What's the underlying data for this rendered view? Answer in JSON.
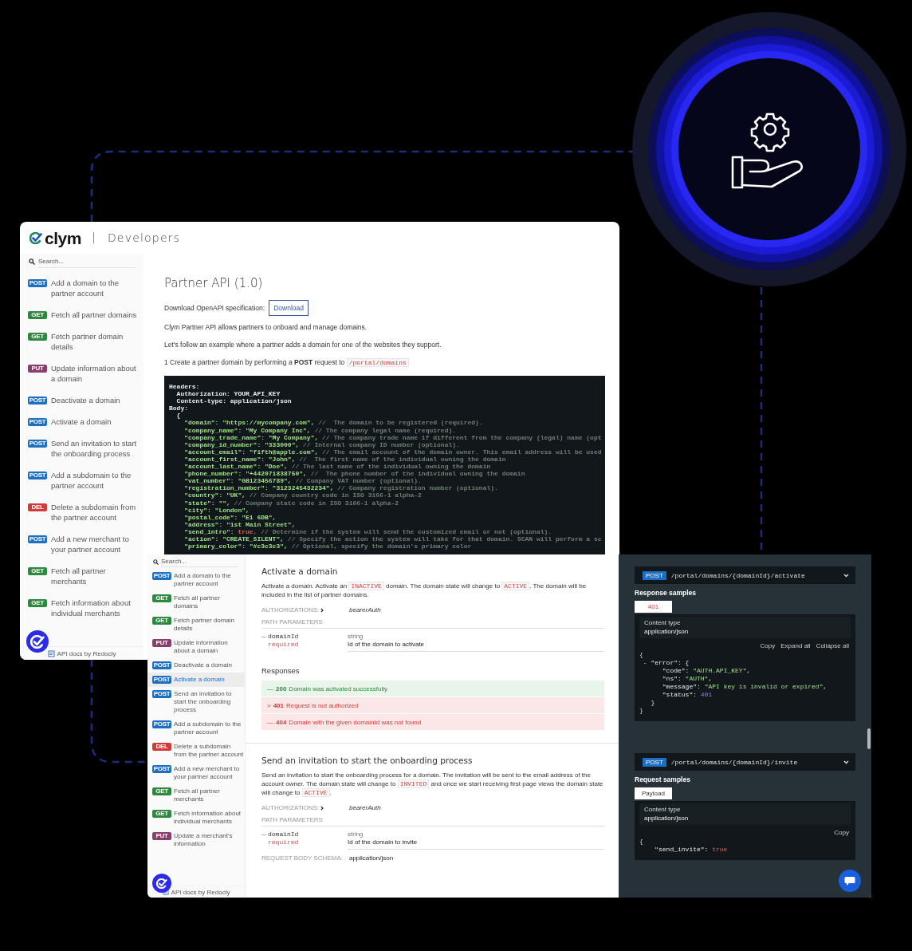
{
  "docs_window": {
    "brand": {
      "logo": "clym",
      "section": "Developers"
    },
    "search": {
      "placeholder": "Search..."
    },
    "sidebar": {
      "items": [
        {
          "method": "POST",
          "label": "Add a domain to the partner account",
          "selected": false
        },
        {
          "method": "GET",
          "label": "Fetch all partner domains",
          "selected": false
        },
        {
          "method": "GET",
          "label": "Fetch partner domain details",
          "selected": false
        },
        {
          "method": "PUT",
          "label": "Update information about a domain",
          "selected": false
        },
        {
          "method": "POST",
          "label": "Deactivate a domain",
          "selected": false
        },
        {
          "method": "POST",
          "label": "Activate a domain",
          "selected": false
        },
        {
          "method": "POST",
          "label": "Send an invitation to start the onboarding process",
          "selected": false
        },
        {
          "method": "POST",
          "label": "Add a subdomain to the partner account",
          "selected": false
        },
        {
          "method": "DEL",
          "label": "Delete a subdomain from the partner account",
          "selected": false
        },
        {
          "method": "POST",
          "label": "Add a new merchant to your partner account",
          "selected": false
        },
        {
          "method": "GET",
          "label": "Fetch all partner merchants",
          "selected": false
        },
        {
          "method": "GET",
          "label": "Fetch information about individual merchants",
          "selected": false
        }
      ]
    },
    "footer": "API docs by Redocly",
    "title": "Partner API (1.0)",
    "download": {
      "label": "Download OpenAPI specification:",
      "button": "Download"
    },
    "paragraphs": [
      "Clym Partner API allows partners to onboard and manage domains.",
      "Let's follow an example where a partner adds a domain for one of the websites they support."
    ],
    "step": {
      "text": "1 Create a partner domain by performing a **POST** request to",
      "code": "/portal/domains"
    },
    "code_block": {
      "lines": [
        [
          {
            "text": "Headers:",
            "kind": "plain"
          }
        ],
        [
          {
            "text": "  Authorization: YOUR_API_KEY",
            "kind": "plain"
          }
        ],
        [
          {
            "text": "  Content-type: application/json",
            "kind": "plain"
          }
        ],
        [
          {
            "text": "Body:",
            "kind": "plain"
          }
        ],
        [
          {
            "text": "  {",
            "kind": "plain"
          }
        ],
        [
          {
            "text": "    \"domain\": \"https://mycompany.com\",",
            "kind": "string"
          },
          {
            "text": " //  The domain to be registered (required).",
            "kind": "comment"
          }
        ],
        [
          {
            "text": "    \"company_name\": \"My Company Inc\",",
            "kind": "string"
          },
          {
            "text": " // The company legal name (required).",
            "kind": "comment"
          }
        ],
        [
          {
            "text": "    \"company_trade_name\": \"My Company\",",
            "kind": "string"
          },
          {
            "text": " // The company trade name if different from the company (legal) name (opt",
            "kind": "comment"
          }
        ],
        [
          {
            "text": "    \"company_id_number\": \"333000\",",
            "kind": "string"
          },
          {
            "text": " // Internal company ID number (optional).",
            "kind": "comment"
          }
        ],
        [
          {
            "text": "    \"account_email\": \"fifth@apple.com\",",
            "kind": "string"
          },
          {
            "text": " // The email account of the domain owner. This email address will be used",
            "kind": "comment"
          }
        ],
        [
          {
            "text": "    \"account_first_name\": \"John\",",
            "kind": "string"
          },
          {
            "text": " //  The first name of the individual owning the domain",
            "kind": "comment"
          }
        ],
        [
          {
            "text": "    \"account_last_name\": \"Doe\",",
            "kind": "string"
          },
          {
            "text": " // The last name of the individual owning the domain",
            "kind": "comment"
          }
        ],
        [
          {
            "text": "    \"phone_number\": \"+442071838750\",",
            "kind": "string"
          },
          {
            "text": " //  The phone number of the individual owning the domain",
            "kind": "comment"
          }
        ],
        [
          {
            "text": "    \"vat_number\": \"GB123456789\",",
            "kind": "string"
          },
          {
            "text": " // Company VAT number (optional).",
            "kind": "comment"
          }
        ],
        [
          {
            "text": "    \"registration_number\": \"3123245432234\",",
            "kind": "string"
          },
          {
            "text": " // Company registration number (optional).",
            "kind": "comment"
          }
        ],
        [
          {
            "text": "    \"country\": \"UK\",",
            "kind": "string"
          },
          {
            "text": " // Company country code in ISO 3166-1 alpha-2",
            "kind": "comment"
          }
        ],
        [
          {
            "text": "    \"state\": \"\",",
            "kind": "string"
          },
          {
            "text": " // Company state code in ISO 3166-1 alpha-2",
            "kind": "comment"
          }
        ],
        [
          {
            "text": "    \"city\": \"London\",",
            "kind": "string"
          }
        ],
        [
          {
            "text": "    \"postal_code\": \"E1 6DB\",",
            "kind": "string"
          }
        ],
        [
          {
            "text": "    \"address\": \"1st Main Street\",",
            "kind": "string"
          }
        ],
        [
          {
            "text": "    \"send_intro\": ",
            "kind": "string"
          },
          {
            "text": "true",
            "kind": "literal"
          },
          {
            "text": ", // Determine if the system will send the customized email or not (optional).",
            "kind": "comment"
          }
        ],
        [
          {
            "text": "    \"action\": \"CREATE_SILENT\",",
            "kind": "string"
          },
          {
            "text": " // Specify the action the system will take for that domain. SCAN will perform a sc",
            "kind": "comment"
          }
        ],
        [
          {
            "text": "    \"primary_color\": \"#c3c3c3\",",
            "kind": "string"
          },
          {
            "text": " // Optional, specify the domain's primary color",
            "kind": "comment"
          }
        ]
      ]
    }
  },
  "reference_window": {
    "search": {
      "placeholder": "Search..."
    },
    "sidebar": {
      "items": [
        {
          "method": "POST",
          "label": "Add a domain to the partner account",
          "selected": false
        },
        {
          "method": "GET",
          "label": "Fetch all partner domains",
          "selected": false
        },
        {
          "method": "GET",
          "label": "Fetch partner domain details",
          "selected": false
        },
        {
          "method": "PUT",
          "label": "Update information about a domain",
          "selected": false
        },
        {
          "method": "POST",
          "label": "Deactivate a domain",
          "selected": false
        },
        {
          "method": "POST",
          "label": "Activate a domain",
          "selected": true
        },
        {
          "method": "POST",
          "label": "Send an invitation to start the onboarding process",
          "selected": false
        },
        {
          "method": "POST",
          "label": "Add a subdomain to the partner account",
          "selected": false
        },
        {
          "method": "DEL",
          "label": "Delete a subdomain from the partner account",
          "selected": false
        },
        {
          "method": "POST",
          "label": "Add a new merchant to your partner account",
          "selected": false
        },
        {
          "method": "GET",
          "label": "Fetch all partner merchants",
          "selected": false
        },
        {
          "method": "GET",
          "label": "Fetch information about individual merchants",
          "selected": false
        },
        {
          "method": "PUT",
          "label": "Update a merchant's information",
          "selected": false
        }
      ]
    },
    "footer": "API docs by Redocly",
    "sections": [
      {
        "title": "Activate a domain",
        "description": [
          {
            "text": "Activate a domain. Activate an ",
            "kind": "text"
          },
          {
            "text": "INACTIVE",
            "kind": "code"
          },
          {
            "text": " domain. The domain state will change to ",
            "kind": "text"
          },
          {
            "text": "ACTIVE",
            "kind": "code"
          },
          {
            "text": ". The domain will be included in the list of partner domains.",
            "kind": "text"
          }
        ],
        "authorizations": {
          "label": "AUTHORIZATIONS:",
          "value": "bearerAuth"
        },
        "path_parameters": {
          "label": "PATH PARAMETERS",
          "params": [
            {
              "name": "domainId",
              "required": "required",
              "type": "string",
              "description": "Id of the domain to activate"
            }
          ]
        },
        "responses": {
          "title": "Responses",
          "items": [
            {
              "marker": "—",
              "code": "200",
              "text": "Domain was activated successfully",
              "kind": "success"
            },
            {
              "marker": ">",
              "code": "401",
              "text": "Request is not authorized",
              "kind": "error"
            },
            {
              "marker": "—",
              "code": "404",
              "text": "Domain with the given domainId was not found",
              "kind": "error"
            }
          ]
        }
      },
      {
        "title": "Send an invitation to start the onboarding process",
        "description": [
          {
            "text": "Send an invitation to start the onboarding process for a domain. The invitation will be sent to the email address of the account owner. The domain state will change to ",
            "kind": "text"
          },
          {
            "text": "INVITED",
            "kind": "code"
          },
          {
            "text": " and once we start receiving first page views the domain state will change to ",
            "kind": "text"
          },
          {
            "text": "ACTIVE",
            "kind": "code"
          },
          {
            "text": ".",
            "kind": "text"
          }
        ],
        "authorizations": {
          "label": "AUTHORIZATIONS:",
          "value": "bearerAuth"
        },
        "path_parameters": {
          "label": "PATH PARAMETERS",
          "params": [
            {
              "name": "domainId",
              "required": "required",
              "type": "string",
              "description": "Id of the domain to invite"
            }
          ]
        },
        "request_body": {
          "label": "REQUEST BODY SCHEMA:",
          "value": "application/json"
        }
      }
    ],
    "samples": [
      {
        "method": "POST",
        "path": "/portal/domains/{domainId}/activate",
        "heading": "Response samples",
        "tabs": [
          {
            "label": "401",
            "selected": true,
            "kind": "error"
          }
        ],
        "content_type": {
          "label": "Content type",
          "value": "application/json"
        },
        "actions": [
          "Copy",
          "Expand all",
          "Collapse all"
        ],
        "lines": [
          [
            {
              "text": "{",
              "kind": "plain"
            }
          ],
          [
            {
              "text": " - ",
              "kind": "plain"
            },
            {
              "text": "\"error\": {",
              "kind": "key"
            }
          ],
          [
            {
              "text": "      \"code\": ",
              "kind": "key"
            },
            {
              "text": "\"AUTH.API_KEY\"",
              "kind": "string"
            },
            {
              "text": ",",
              "kind": "plain"
            }
          ],
          [
            {
              "text": "      \"ns\": ",
              "kind": "key"
            },
            {
              "text": "\"AUTH\"",
              "kind": "string"
            },
            {
              "text": ",",
              "kind": "plain"
            }
          ],
          [
            {
              "text": "      \"message\": ",
              "kind": "key"
            },
            {
              "text": "\"API key is invalid or expired\"",
              "kind": "string"
            },
            {
              "text": ",",
              "kind": "plain"
            }
          ],
          [
            {
              "text": "      \"status\": ",
              "kind": "key"
            },
            {
              "text": "401",
              "kind": "number"
            }
          ],
          [
            {
              "text": "   }",
              "kind": "plain"
            }
          ],
          [
            {
              "text": "}",
              "kind": "plain"
            }
          ]
        ]
      },
      {
        "method": "POST",
        "path": "/portal/domains/{domainId}/invite",
        "heading": "Request samples",
        "tabs": [
          {
            "label": "Payload",
            "selected": true,
            "kind": "neutral"
          }
        ],
        "content_type": {
          "label": "Content type",
          "value": "application/json"
        },
        "actions": [
          "Copy"
        ],
        "lines": [
          [
            {
              "text": "{",
              "kind": "plain"
            }
          ],
          [
            {
              "text": "    \"send_invite\": ",
              "kind": "key"
            },
            {
              "text": "true",
              "kind": "literal"
            }
          ]
        ]
      }
    ]
  }
}
